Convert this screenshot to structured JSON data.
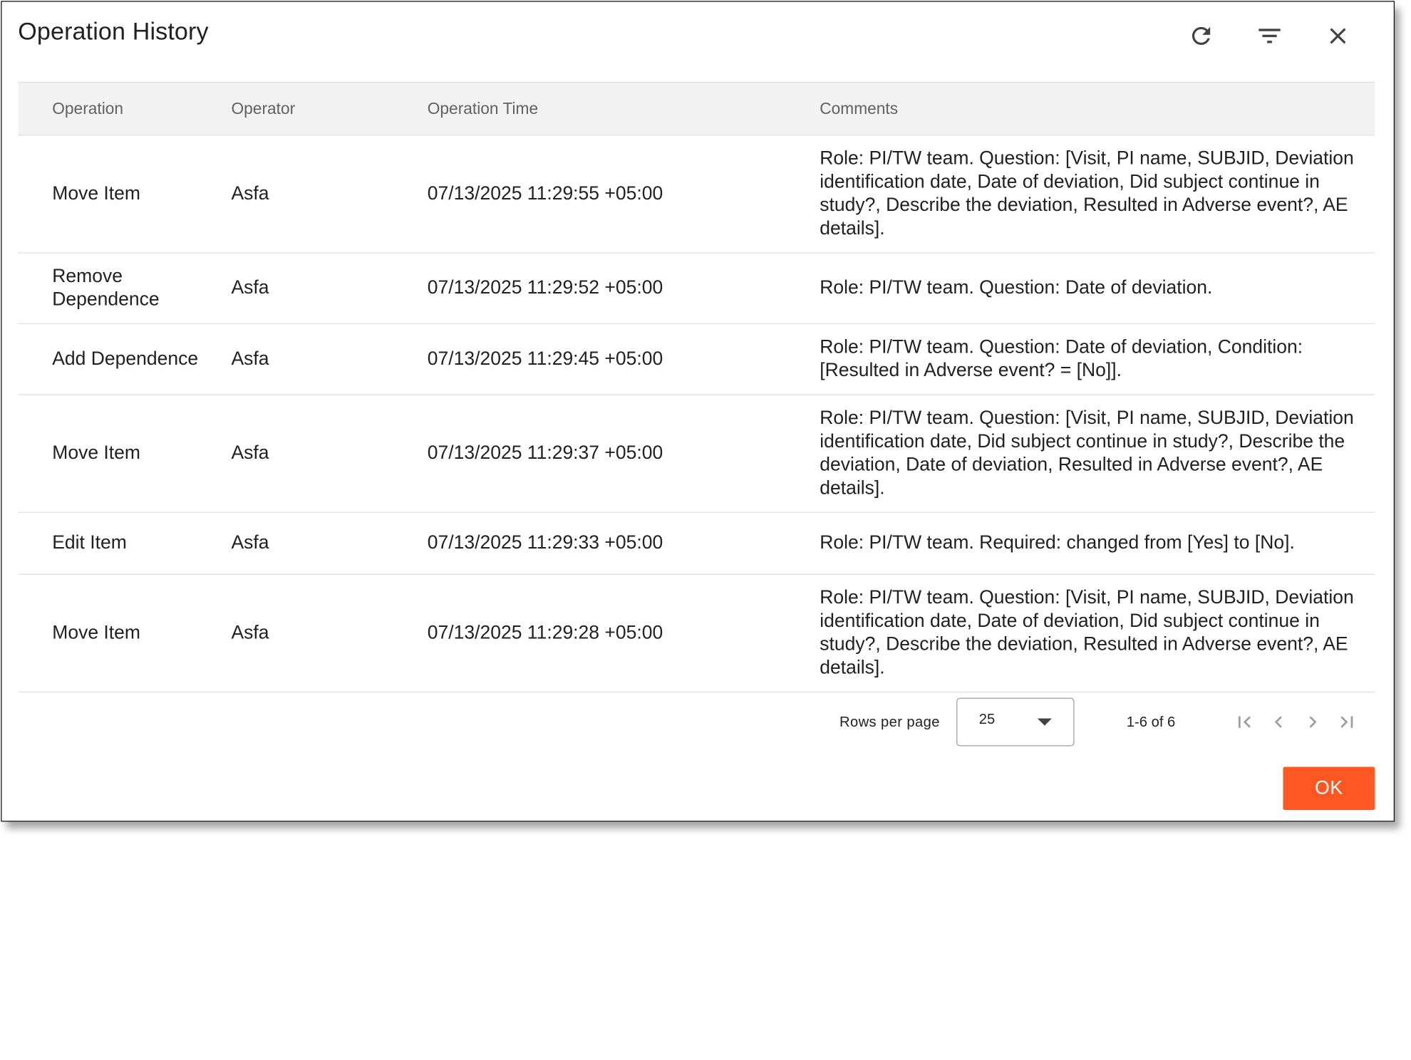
{
  "dialog": {
    "title": "Operation History",
    "icons": {
      "refresh": "refresh-icon",
      "filter": "filter-icon",
      "close": "close-icon"
    }
  },
  "table": {
    "columns": [
      "Operation",
      "Operator",
      "Operation Time",
      "Comments"
    ],
    "rows": [
      {
        "operation": "Move Item",
        "operator": "Asfa",
        "time": "07/13/2025 11:29:55 +05:00",
        "comments": "Role: PI/TW team. Question: [Visit, PI name, SUBJID, Deviation identification date, Date of deviation, Did subject continue in study?, Describe the deviation, Resulted in Adverse event?, AE details]."
      },
      {
        "operation": "Remove Dependence",
        "operator": "Asfa",
        "time": "07/13/2025 11:29:52 +05:00",
        "comments": "Role: PI/TW team. Question: Date of deviation."
      },
      {
        "operation": "Add Dependence",
        "operator": "Asfa",
        "time": "07/13/2025 11:29:45 +05:00",
        "comments": "Role: PI/TW team. Question: Date of deviation, Condition: [Resulted in Adverse event? = [No]]."
      },
      {
        "operation": "Move Item",
        "operator": "Asfa",
        "time": "07/13/2025 11:29:37 +05:00",
        "comments": "Role: PI/TW team. Question: [Visit, PI name, SUBJID, Deviation identification date, Did subject continue in study?, Describe the deviation, Date of deviation, Resulted in Adverse event?, AE details]."
      },
      {
        "operation": "Edit Item",
        "operator": "Asfa",
        "time": "07/13/2025 11:29:33 +05:00",
        "comments": "Role: PI/TW team. Required: changed from [Yes] to [No]."
      },
      {
        "operation": "Move Item",
        "operator": "Asfa",
        "time": "07/13/2025 11:29:28 +05:00",
        "comments": "Role: PI/TW team. Question: [Visit, PI name, SUBJID, Deviation identification date, Date of deviation, Did subject continue in study?, Describe the deviation, Resulted in Adverse event?, AE details]."
      }
    ]
  },
  "pagination": {
    "rows_per_page_label": "Rows per page",
    "rows_per_page_value": "25",
    "range_text": "1-6 of 6",
    "icons": {
      "first": "first-page-icon",
      "prev": "chevron-left-icon",
      "next": "chevron-right-icon",
      "last": "last-page-icon"
    }
  },
  "actions": {
    "ok_label": "OK"
  },
  "colors": {
    "accent": "#ff5722",
    "header_bg": "#f2f2f2",
    "divider": "#e0e0e0",
    "text": "#212121",
    "muted_text": "#616161"
  }
}
